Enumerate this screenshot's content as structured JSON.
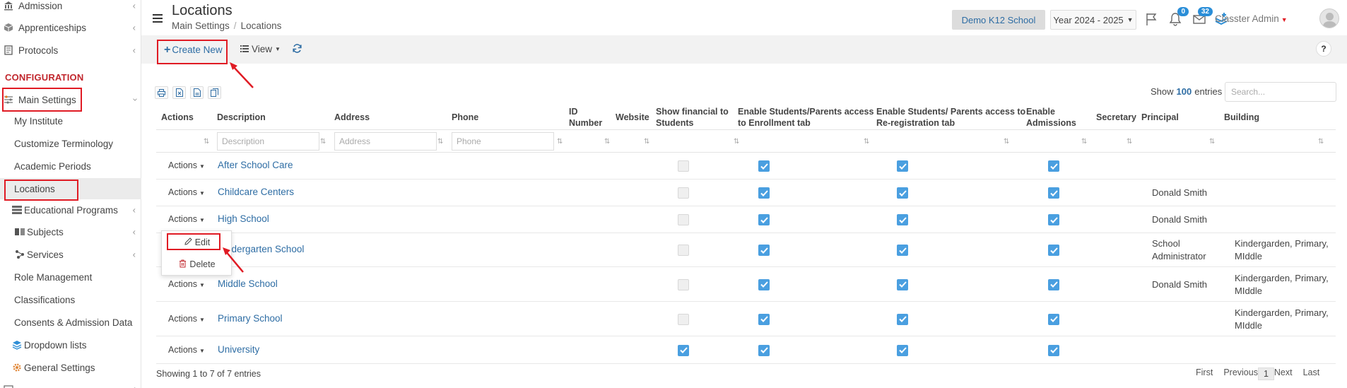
{
  "sidebar": {
    "items": [
      {
        "label": "Admission",
        "chevron": true
      },
      {
        "label": "Apprenticeships",
        "chevron": true
      },
      {
        "label": "Protocols",
        "chevron": true
      }
    ],
    "section_label": "CONFIGURATION",
    "main_settings": {
      "label": "Main Settings"
    },
    "sub_items": [
      {
        "label": "My Institute"
      },
      {
        "label": "Customize Terminology"
      },
      {
        "label": "Academic Periods"
      },
      {
        "label": "Locations"
      },
      {
        "label": "Educational Programs"
      },
      {
        "label": "Subjects"
      },
      {
        "label": "Services"
      },
      {
        "label": "Role Management"
      },
      {
        "label": "Classifications"
      },
      {
        "label": "Consents & Admission Data"
      },
      {
        "label": "Dropdown lists"
      },
      {
        "label": "General Settings"
      }
    ]
  },
  "header": {
    "title": "Locations",
    "breadcrumb": [
      "Main Settings",
      "Locations"
    ],
    "school": "Demo K12 School",
    "year": "Year 2024 - 2025",
    "notifications_count": "0",
    "messages_count": "32",
    "user": "Classter Admin"
  },
  "toolbar": {
    "create_label": "Create New",
    "view_label": "View",
    "help_label": "?"
  },
  "table": {
    "show_label": "Show",
    "entries_count": "100",
    "entries_label": "entries",
    "search_placeholder": "Search...",
    "columns": {
      "actions": "Actions",
      "description": "Description",
      "address": "Address",
      "phone": "Phone",
      "id_number_1": "ID",
      "id_number_2": "Number",
      "website": "Website",
      "show_financial_1": "Show financial to",
      "show_financial_2": "Students",
      "enrollment_1": "Enable Students/Parents access",
      "enrollment_2": "to Enrollment tab",
      "reregistration_1": "Enable Students/ Parents access to",
      "reregistration_2": "Re-registration tab",
      "admissions_1": "Enable",
      "admissions_2": "Admissions",
      "secretary": "Secretary",
      "principal": "Principal",
      "building": "Building"
    },
    "filters": {
      "description": "Description",
      "address": "Address",
      "phone": "Phone"
    },
    "action_label": "Actions",
    "rows": [
      {
        "description": "After School Care",
        "principal": "",
        "building": "",
        "financial": false,
        "enrollment": true,
        "reregistration": true,
        "admissions": true
      },
      {
        "description": "Childcare Centers",
        "principal": "Donald Smith",
        "building": "",
        "financial": false,
        "enrollment": true,
        "reregistration": true,
        "admissions": true
      },
      {
        "description": "High School",
        "principal": "Donald Smith",
        "building": "",
        "financial": false,
        "enrollment": true,
        "reregistration": true,
        "admissions": true
      },
      {
        "description": "Kindergarten School",
        "principal": "School Administrator",
        "building": "Kindergarden, Primary, MIddle",
        "financial": false,
        "enrollment": true,
        "reregistration": true,
        "admissions": true
      },
      {
        "description": "Middle School",
        "principal": "Donald Smith",
        "building": "Kindergarden, Primary, MIddle",
        "financial": false,
        "enrollment": true,
        "reregistration": true,
        "admissions": true
      },
      {
        "description": "Primary School",
        "principal": "",
        "building": "Kindergarden, Primary, MIddle",
        "financial": false,
        "enrollment": true,
        "reregistration": true,
        "admissions": true
      },
      {
        "description": "University",
        "principal": "",
        "building": "",
        "financial": true,
        "enrollment": true,
        "reregistration": true,
        "admissions": true
      }
    ],
    "dropdown": {
      "edit": "Edit",
      "delete": "Delete"
    },
    "footer_info": "Showing 1 to 7 of 7 entries",
    "pager": {
      "first": "First",
      "previous": "Previous",
      "page": "1",
      "next": "Next",
      "last": "Last"
    }
  },
  "colors": {
    "accent": "#2e6da4",
    "highlight": "#e01b24",
    "checkbox": "#4a9fe0",
    "section": "#c1272d"
  }
}
